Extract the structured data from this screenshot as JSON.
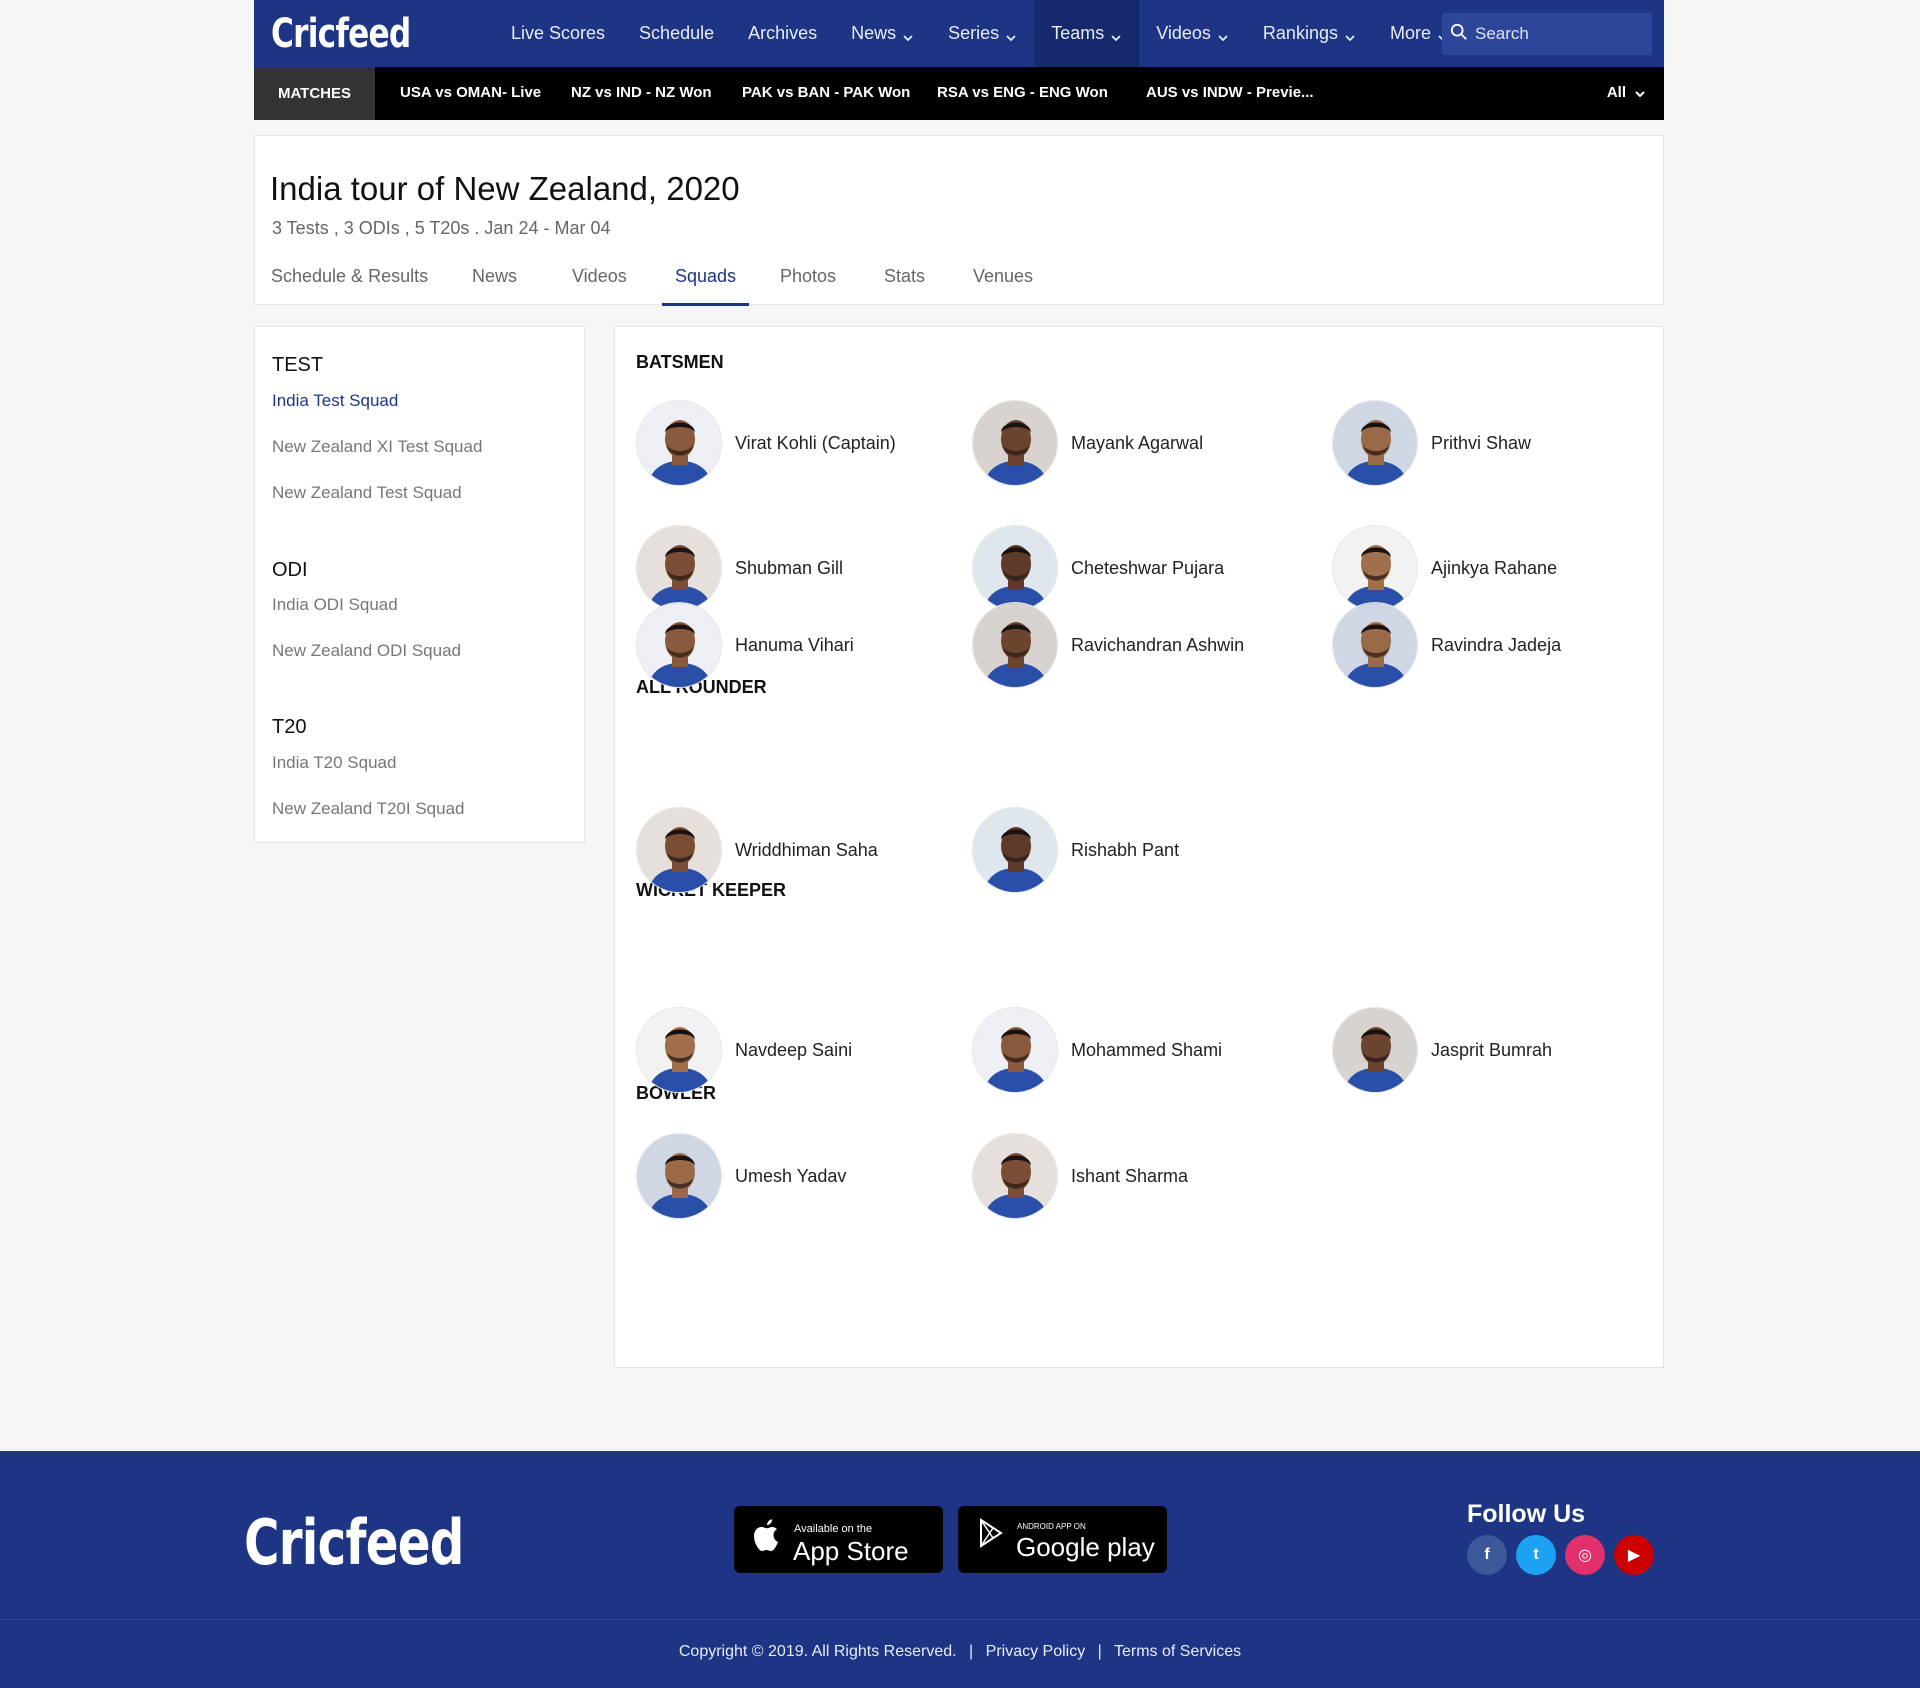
{
  "brand": "Cricfeed",
  "nav": {
    "items": [
      {
        "label": "Live Scores",
        "dropdown": false
      },
      {
        "label": "Schedule",
        "dropdown": false
      },
      {
        "label": "Archives",
        "dropdown": false
      },
      {
        "label": "News",
        "dropdown": true
      },
      {
        "label": "Series",
        "dropdown": true
      },
      {
        "label": "Teams",
        "dropdown": true,
        "active": true
      },
      {
        "label": "Videos",
        "dropdown": true
      },
      {
        "label": "Rankings",
        "dropdown": true
      },
      {
        "label": "More",
        "dropdown": true
      }
    ],
    "search_placeholder": "Search"
  },
  "matchbar": {
    "tag": "MATCHES",
    "matches": [
      "USA vs OMAN- Live",
      "NZ vs IND - NZ Won",
      "PAK vs BAN - PAK Won",
      "RSA vs  ENG - ENG Won",
      "AUS vs INDW - Previe..."
    ],
    "filter": "All"
  },
  "series": {
    "title": "India tour of New Zealand, 2020",
    "subtitle": "3 Tests , 3 ODIs , 5 T20s . Jan 24 - Mar 04",
    "tabs": [
      "Schedule & Results",
      "News",
      "Videos",
      "Squads",
      "Photos",
      "Stats",
      "Venues"
    ],
    "active_tab": "Squads"
  },
  "sidebar": {
    "groups": [
      {
        "heading": "TEST",
        "items": [
          "India Test Squad",
          "New Zealand XI Test Squad",
          "New Zealand Test Squad"
        ]
      },
      {
        "heading": "ODI",
        "items": [
          "India ODI Squad",
          "New Zealand ODI Squad"
        ]
      },
      {
        "heading": "T20",
        "items": [
          "India T20 Squad",
          "New Zealand T20I Squad"
        ]
      }
    ],
    "active_item": "India Test Squad"
  },
  "squad": {
    "roles": [
      {
        "heading": "BATSMEN",
        "players": [
          "Virat Kohli (Captain)",
          "Mayank Agarwal",
          "Prithvi Shaw",
          "Shubman Gill",
          "Cheteshwar Pujara",
          "Ajinkya Rahane"
        ]
      },
      {
        "heading": "ALL ROUNDER",
        "players": [
          "Hanuma Vihari",
          "Ravichandran Ashwin",
          "Ravindra Jadeja"
        ]
      },
      {
        "heading": "WICKET KEEPER",
        "players": [
          "Wriddhiman Saha",
          "Rishabh Pant"
        ]
      },
      {
        "heading": "BOWLER",
        "players": [
          "Navdeep Saini",
          "Mohammed Shami",
          "Jasprit Bumrah",
          "Umesh Yadav",
          "Ishant Sharma"
        ]
      }
    ]
  },
  "footer": {
    "brand": "Cricfeed",
    "app_store": {
      "small": "Available on the",
      "big": "App Store"
    },
    "google_play": {
      "small": "ANDROID APP ON",
      "big": "Google play"
    },
    "follow_title": "Follow Us",
    "social": [
      {
        "name": "facebook",
        "glyph": "f",
        "color": "#3b5998"
      },
      {
        "name": "twitter",
        "glyph": "t",
        "color": "#1da1f2"
      },
      {
        "name": "instagram",
        "glyph": "◎",
        "color": "#e1306c"
      },
      {
        "name": "youtube",
        "glyph": "▶",
        "color": "#cc0000"
      }
    ],
    "copyright": "Copyright © 2019. All Rights Reserved.",
    "privacy": "Privacy Policy",
    "terms": "Terms of Services"
  },
  "colors": {
    "brand_blue": "#1d3584",
    "active_nav": "#16296c",
    "match_bar": "#000000"
  }
}
